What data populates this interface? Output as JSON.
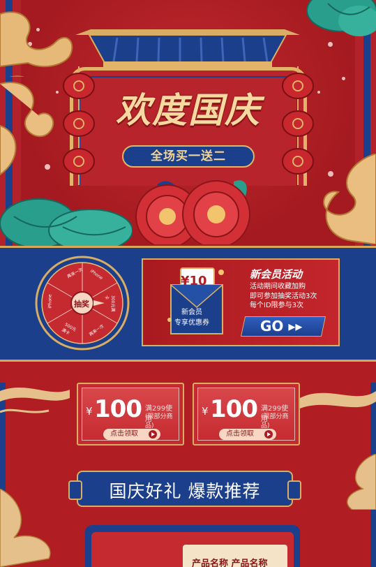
{
  "hero": {
    "title": "欢度国庆",
    "subtitle": "全场买一送二"
  },
  "wheel": {
    "center_label": "抽奖",
    "segments": [
      "再来一次",
      "iPhone",
      "300元满卡",
      "再来一次",
      "500元满卡",
      "iPhone"
    ]
  },
  "member": {
    "coupon_amount": "¥10",
    "coupon_label_line1": "新会员",
    "coupon_label_line2": "专享优惠券",
    "title": "新会员活动",
    "desc_lines": [
      "活动期间收藏加购",
      "即可参加抽奖活动3次",
      "每个ID限参与3次"
    ],
    "go_label": "GO ▸▸"
  },
  "coupons": [
    {
      "currency": "¥",
      "amount": "100",
      "condition": "满299使用",
      "note": "(限部分商品)",
      "button": "点击领取"
    },
    {
      "currency": "¥",
      "amount": "100",
      "condition": "满299使用",
      "note": "(限部分商品)",
      "button": "点击领取"
    }
  ],
  "section_banner": "国庆好礼 爆款推荐",
  "product": {
    "name": "产品名称 产品名称"
  },
  "colors": {
    "red": "#b01d22",
    "navy": "#1c3f8c",
    "gold": "#d9ae64",
    "teal": "#2a9e8c"
  }
}
